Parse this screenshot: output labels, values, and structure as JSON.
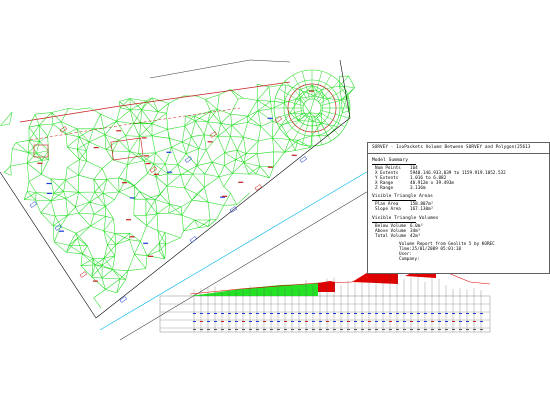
{
  "report": {
    "title": "SURVEY - IsoPackets Volume Between SURVEY and Polygon(25613",
    "model_summary": {
      "heading": "Model Summary",
      "rows": [
        {
          "label": "Num Points",
          "value": "164"
        },
        {
          "label": "X Extents",
          "value": "5940.146.933,039 to 1159.919.1052.532"
        },
        {
          "label": "Y Extents",
          "value": "1.016 to 6.882"
        },
        {
          "label": "X Range",
          "value": "48.912m x 39.493m"
        },
        {
          "label": "Z Range",
          "value": "3.136m"
        }
      ]
    },
    "visible_areas": {
      "heading": "Visible Triangle Areas",
      "rows": [
        {
          "label": "Plan Area",
          "value": "158.807m²"
        },
        {
          "label": "Slope Area",
          "value": "167.130m²"
        }
      ]
    },
    "visible_volumes": {
      "heading": "Visible Triangle Volumes",
      "rows": [
        {
          "label": "Below Volume",
          "value": "6.0m³"
        },
        {
          "label": "Above Volume",
          "value": "34m³"
        },
        {
          "label": "Total Volume",
          "value": "42m³"
        }
      ]
    },
    "footer": [
      "Volume Report from Geolite 5 by KOREC",
      "Time:25/01/2009 05:01:10",
      "User:",
      "Company:"
    ]
  },
  "colors": {
    "tin": "#22dd22",
    "breakline": "#c81e1e",
    "boundary": "#000000",
    "profile_cut": "#e00000",
    "profile_fill": "#00dd00",
    "cyan": "#00b4e6",
    "blue_text": "#1e3cdc"
  }
}
